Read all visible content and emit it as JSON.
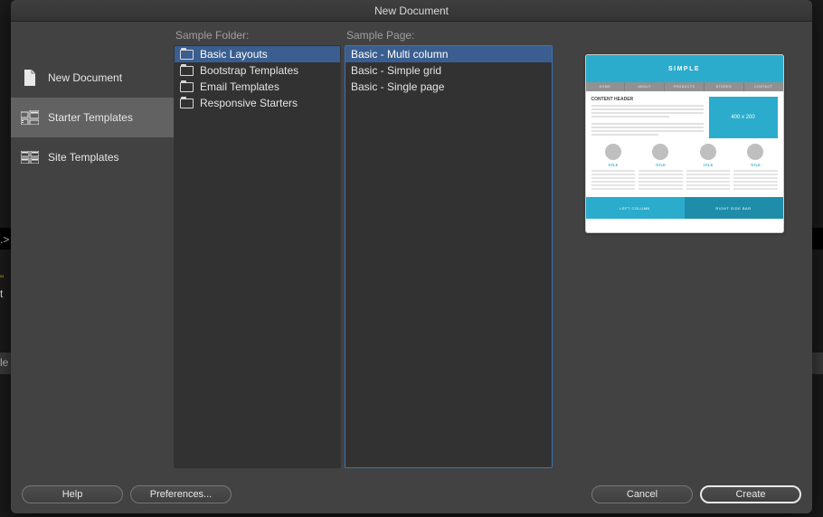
{
  "window": {
    "title": "New Document"
  },
  "sidebar": {
    "items": [
      {
        "label": "New Document"
      },
      {
        "label": "Starter Templates"
      },
      {
        "label": "Site Templates"
      }
    ],
    "selected": 1
  },
  "folders": {
    "label": "Sample Folder:",
    "items": [
      {
        "label": "Basic Layouts"
      },
      {
        "label": "Bootstrap Templates"
      },
      {
        "label": "Email Templates"
      },
      {
        "label": "Responsive Starters"
      }
    ],
    "selected": 0
  },
  "pages": {
    "label": "Sample Page:",
    "items": [
      {
        "label": "Basic - Multi column"
      },
      {
        "label": "Basic - Simple grid"
      },
      {
        "label": "Basic - Single page"
      }
    ],
    "selected": 0
  },
  "preview": {
    "header": "SIMPLE",
    "nav": [
      "HOME",
      "ABOUT",
      "PRODUCTS",
      "STORES",
      "CONTACT"
    ],
    "hero_title": "CONTENT HEADER",
    "hero_img_label": "400 x 200",
    "col_labels": [
      "TITLE",
      "TITLE",
      "TITLE",
      "TITLE"
    ],
    "footer_left": "LEFT COLUMN",
    "footer_right": "RIGHT SIDE BAR"
  },
  "buttons": {
    "help": "Help",
    "preferences": "Preferences...",
    "cancel": "Cancel",
    "create": "Create"
  }
}
